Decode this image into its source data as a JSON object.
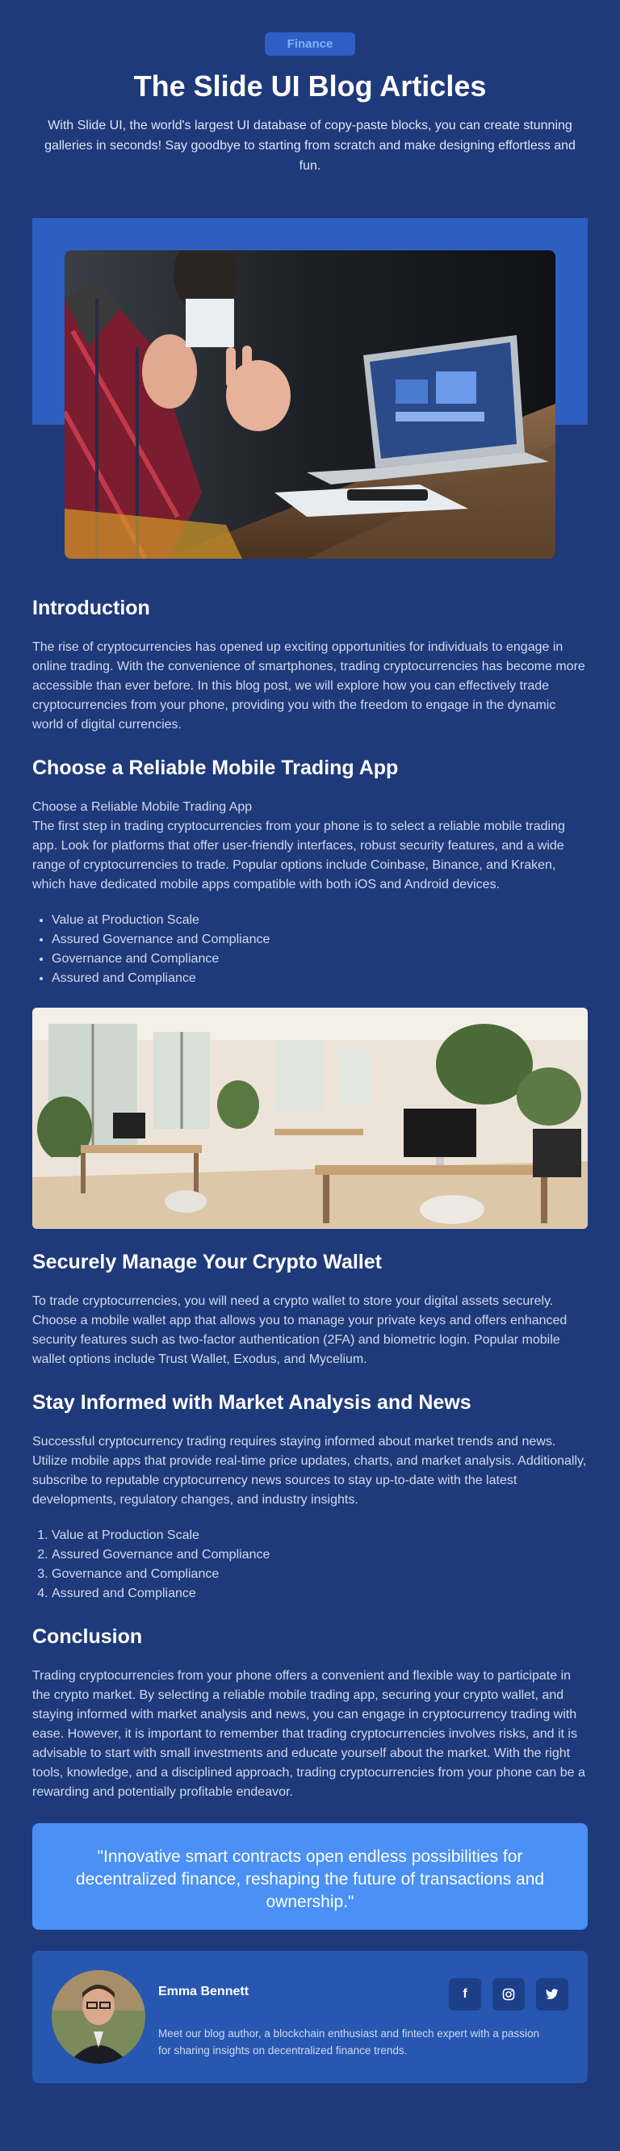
{
  "header": {
    "tag": "Finance",
    "title": "The Slide UI Blog Articles",
    "subtitle": "With Slide UI, the world's largest UI database of copy-paste blocks, you can create stunning galleries in seconds! Say goodbye to starting from scratch and make designing effortless and fun."
  },
  "sections": {
    "intro": {
      "heading": "Introduction",
      "body": "The rise of cryptocurrencies has opened up exciting opportunities for individuals to engage in online trading. With the convenience of smartphones, trading cryptocurrencies has become more accessible than ever before. In this blog post, we will explore how you can effectively trade cryptocurrencies from your phone, providing you with the freedom to engage in the dynamic world of digital currencies."
    },
    "app": {
      "heading": "Choose a Reliable Mobile Trading App",
      "subheading": "Choose a Reliable Mobile Trading App",
      "body": "The first step in trading cryptocurrencies from your phone is to select a reliable mobile trading app. Look for platforms that offer user-friendly interfaces, robust security features, and a wide range of cryptocurrencies to trade. Popular options include Coinbase, Binance, and Kraken, which have dedicated mobile apps compatible with both iOS and Android devices.",
      "list": [
        "Value at Production Scale",
        "Assured Governance and Compliance",
        "Governance and Compliance",
        "Assured and Compliance"
      ]
    },
    "wallet": {
      "heading": "Securely Manage Your Crypto Wallet",
      "body": "To trade cryptocurrencies, you will need a crypto wallet to store your digital assets securely. Choose a mobile wallet app that allows you to manage your private keys and offers enhanced security features such as two-factor authentication (2FA) and biometric login. Popular mobile wallet options include Trust Wallet, Exodus, and Mycelium."
    },
    "news": {
      "heading": "Stay Informed with Market Analysis and News",
      "body": "Successful cryptocurrency trading requires staying informed about market trends and news. Utilize mobile apps that provide real-time price updates, charts, and market analysis. Additionally, subscribe to reputable cryptocurrency news sources to stay up-to-date with the latest developments, regulatory changes, and industry insights.",
      "list": [
        "Value at Production Scale",
        "Assured Governance and Compliance",
        "Governance and Compliance",
        "Assured and Compliance"
      ]
    },
    "conclusion": {
      "heading": "Conclusion",
      "body": "Trading cryptocurrencies from your phone offers a convenient and flexible way to participate in the crypto market. By selecting a reliable mobile trading app, securing your crypto wallet, and staying informed with market analysis and news, you can engage in cryptocurrency trading with ease. However, it is important to remember that trading cryptocurrencies involves risks, and it is advisable to start with small investments and educate yourself about the market. With the right tools, knowledge, and a disciplined approach, trading cryptocurrencies from your phone can be a rewarding and potentially profitable endeavor."
    }
  },
  "quote": "\"Innovative smart contracts open endless possibilities for decentralized finance, reshaping the future of transactions and ownership.\"",
  "author": {
    "name": "Emma Bennett",
    "bio": "Meet our blog author, a blockchain enthusiast and fintech expert with a passion for sharing insights on decentralized finance trends.",
    "socials": [
      "facebook-icon",
      "instagram-icon",
      "twitter-icon"
    ]
  },
  "colors": {
    "background": "#1f3a7a",
    "accent": "#2d5fc0",
    "quote_bg": "#4a90f5",
    "tag_text": "#7fb0ff"
  }
}
